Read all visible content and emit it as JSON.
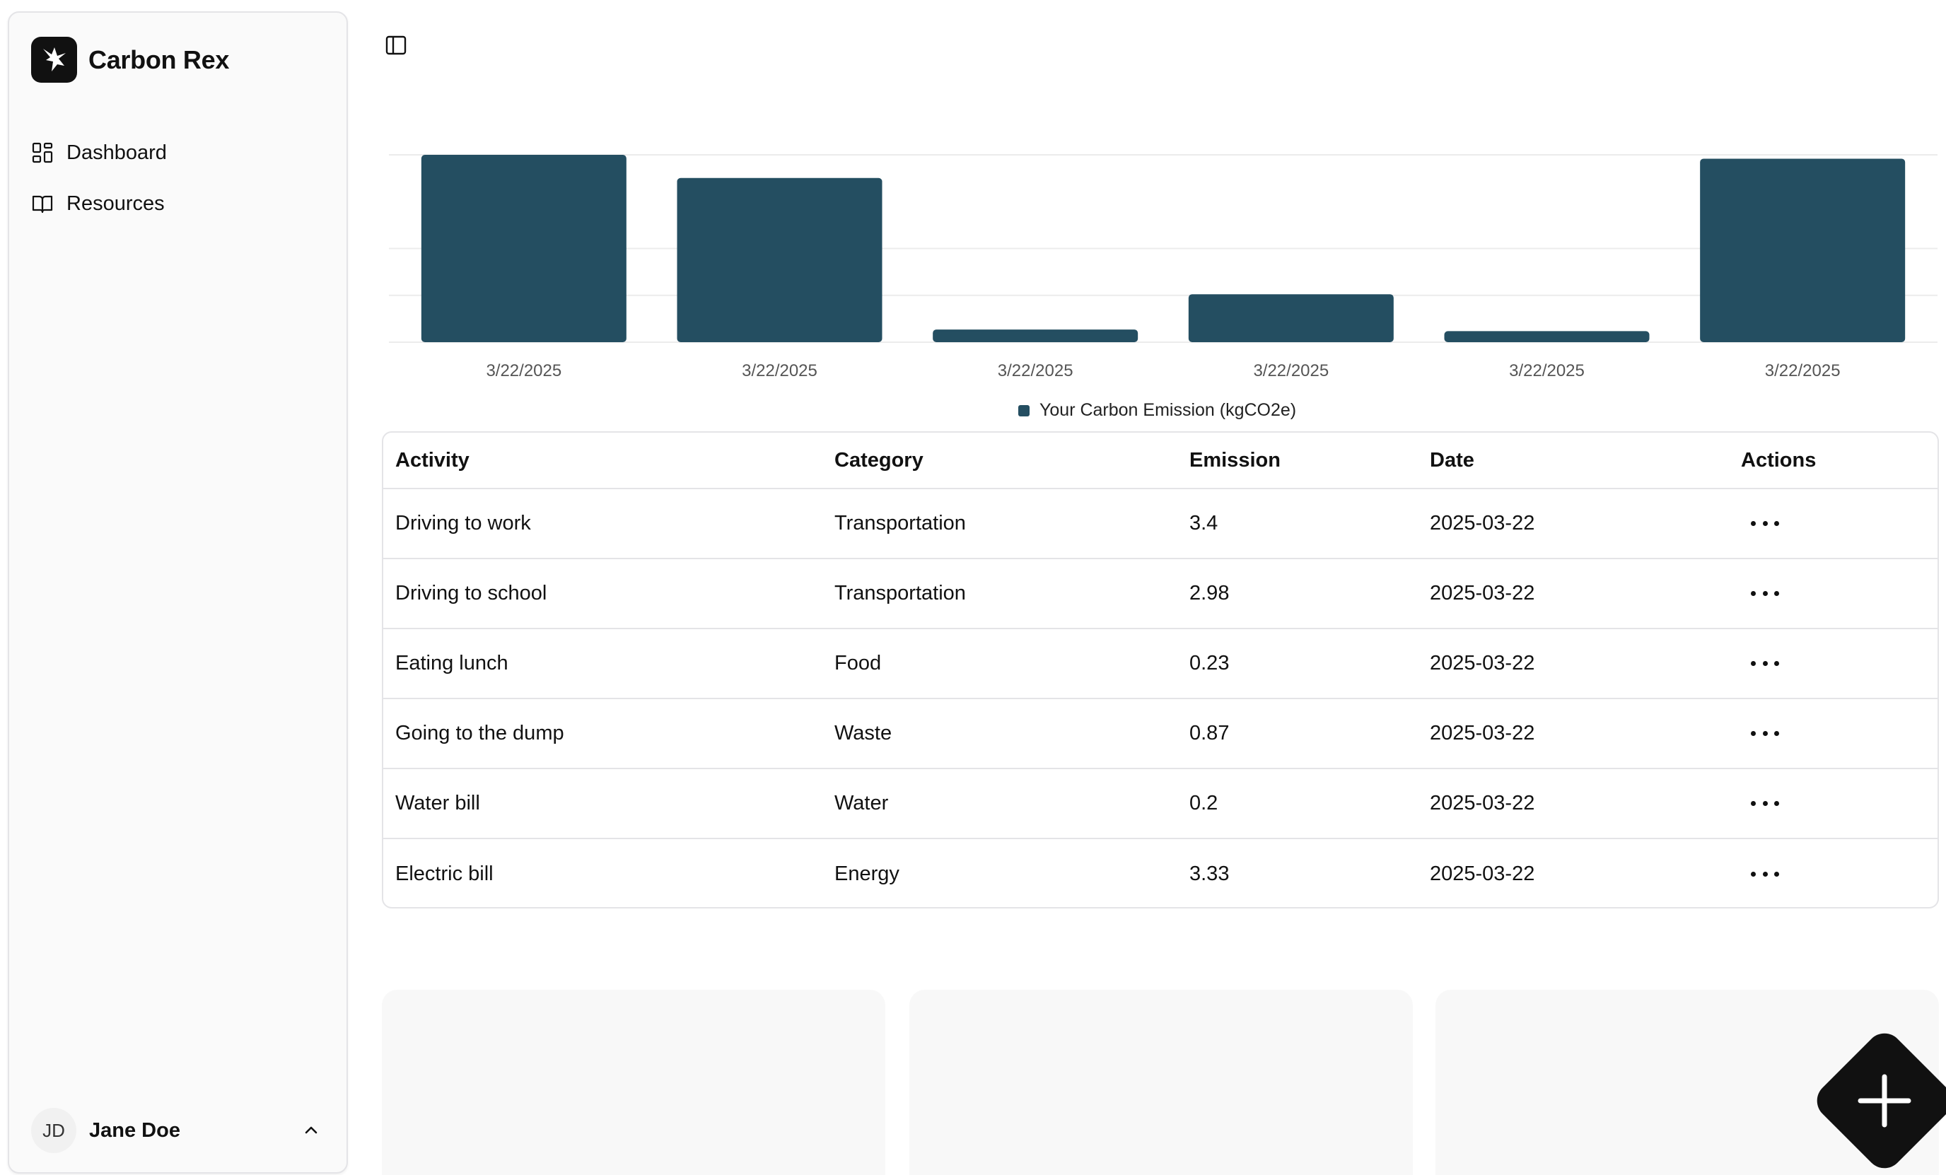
{
  "app": {
    "name": "Carbon Rex"
  },
  "sidebar": {
    "items": [
      {
        "label": "Dashboard",
        "icon": "dashboard-icon"
      },
      {
        "label": "Resources",
        "icon": "book-icon"
      }
    ],
    "user": {
      "initials": "JD",
      "name": "Jane Doe"
    }
  },
  "colors": {
    "bar": "#244e61",
    "fab": "#111111"
  },
  "chart_data": {
    "type": "bar",
    "categories": [
      "3/22/2025",
      "3/22/2025",
      "3/22/2025",
      "3/22/2025",
      "3/22/2025",
      "3/22/2025"
    ],
    "series": [
      {
        "name": "Your Carbon Emission (kgCO2e)",
        "values": [
          3.4,
          2.98,
          0.23,
          0.87,
          0.2,
          3.33
        ]
      }
    ],
    "ylim": [
      0,
      3.4
    ],
    "grid": true,
    "legend": "bottom-center"
  },
  "table": {
    "headers": [
      "Activity",
      "Category",
      "Emission",
      "Date",
      "Actions"
    ],
    "rows": [
      [
        "Driving to work",
        "Transportation",
        "3.4",
        "2025-03-22"
      ],
      [
        "Driving to school",
        "Transportation",
        "2.98",
        "2025-03-22"
      ],
      [
        "Eating lunch",
        "Food",
        "0.23",
        "2025-03-22"
      ],
      [
        "Going to the dump",
        "Waste",
        "0.87",
        "2025-03-22"
      ],
      [
        "Water bill",
        "Water",
        "0.2",
        "2025-03-22"
      ],
      [
        "Electric bill",
        "Energy",
        "3.33",
        "2025-03-22"
      ]
    ]
  }
}
